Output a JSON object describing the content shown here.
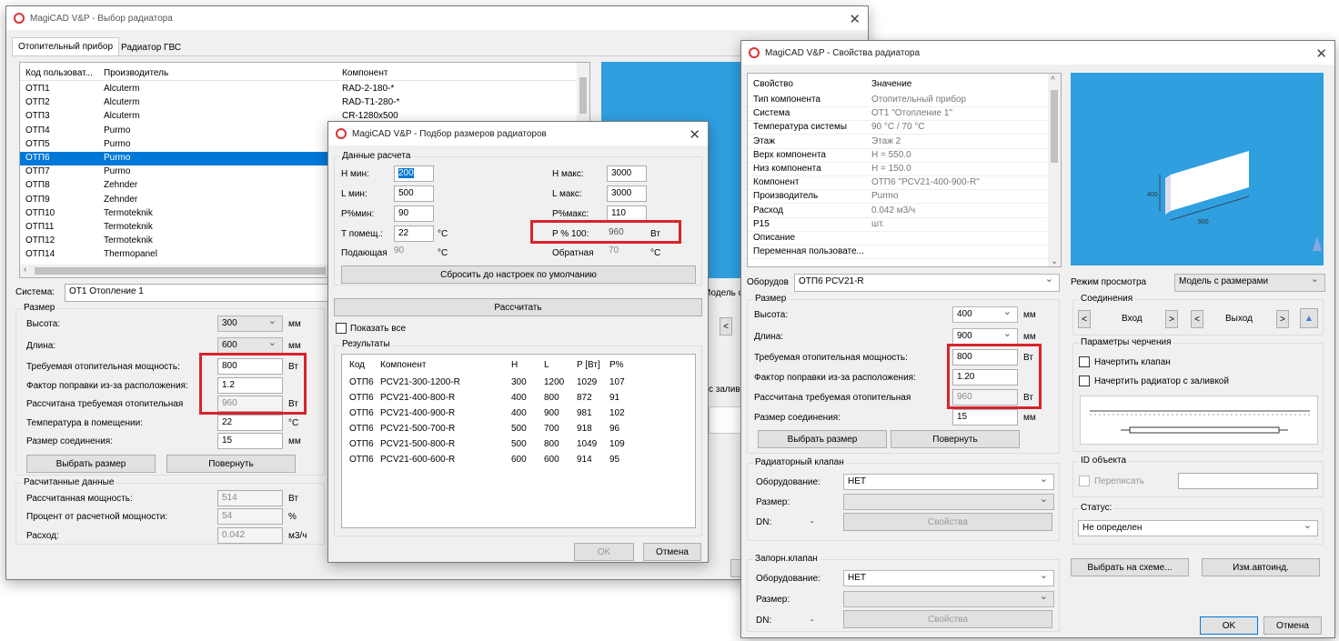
{
  "w1": {
    "title": "MagiCAD V&P - Выбор радиатора",
    "tabs": [
      "Отопительный прибор",
      "Радиатор ГВС"
    ],
    "cols": [
      "Код пользоват...",
      "Производитель",
      "Компонент"
    ],
    "rows": [
      [
        "ОТП1",
        "Alcuterm",
        "RAD-2-180-*"
      ],
      [
        "ОТП2",
        "Alcuterm",
        "RAD-T1-280-*"
      ],
      [
        "ОТП3",
        "Alcuterm",
        "CR-1280x500"
      ],
      [
        "ОТП4",
        "Purmo",
        ""
      ],
      [
        "ОТП5",
        "Purmo",
        ""
      ],
      [
        "ОТП6",
        "Purmo",
        ""
      ],
      [
        "ОТП7",
        "Purmo",
        ""
      ],
      [
        "ОТП8",
        "Zehnder",
        ""
      ],
      [
        "ОТП9",
        "Zehnder",
        ""
      ],
      [
        "ОТП10",
        "Termoteknik",
        ""
      ],
      [
        "ОТП11",
        "Termoteknik",
        ""
      ],
      [
        "ОТП12",
        "Termoteknik",
        ""
      ],
      [
        "ОТП14",
        "Thermopanel",
        ""
      ]
    ],
    "system_label": "Система:",
    "system_value": "ОТ1 Отопление 1",
    "size_group": "Размер",
    "height_label": "Высота:",
    "height_value": "300",
    "length_label": "Длина:",
    "length_value": "600",
    "mm": "мм",
    "req_power_label": "Требуемая отопительная мощность:",
    "req_power_value": "800",
    "vt": "Вт",
    "factor_label": "Фактор поправки из-за расположения:",
    "factor_value": "1.2",
    "calc_req_label": "Рассчитана требуемая отопительная",
    "calc_req_value": "960",
    "room_temp_label": "Температура в помещении:",
    "room_temp_value": "22",
    "deg": "°C",
    "conn_label": "Размер соединения:",
    "conn_value": "15",
    "select_size_btn": "Выбрать размер",
    "rotate_btn": "Повернуть",
    "calc_group": "Расчитанные данные",
    "calc_power_label": "Рассчитанная мощность:",
    "calc_power_value": "514",
    "percent_label": "Процент от расчетной мощности:",
    "percent_value": "54",
    "pct": "%",
    "flow_label": "Расход:",
    "flow_value": "0.042",
    "flow_unit": "м3/ч",
    "partial": [
      "Модель с",
      "с залив"
    ]
  },
  "w2": {
    "title": "MagiCAD V&P - Подбор размеров радиаторов",
    "calc_group": "Данные расчета",
    "hmin_label": "H мин:",
    "hmin": "200",
    "lmin_label": "L мин:",
    "lmin": "500",
    "pmin_label": "P%мин:",
    "pmin": "90",
    "troom_label": "T помещ.:",
    "troom": "22",
    "supply_label": "Подающая",
    "supply": "90",
    "hmax_label": "H макс:",
    "hmax": "3000",
    "lmax_label": "L макс:",
    "lmax": "3000",
    "pmax_label": "P%макс:",
    "pmax": "110",
    "p100_label": "P % 100:",
    "p100": "960",
    "p100_unit": "Вт",
    "return_label": "Обратная",
    "return": "70",
    "deg": "°C",
    "reset_btn": "Сбросить до настроек по умолчанию",
    "calc_btn": "Рассчитать",
    "show_all": "Показать все",
    "results_label": "Результаты",
    "res_cols": [
      "Код",
      "Компонент",
      "H",
      "L",
      "P [Вт]",
      "P%"
    ],
    "res_rows": [
      [
        "ОТП6",
        "PCV21-300-1200-R",
        "300",
        "1200",
        "1029",
        "107"
      ],
      [
        "ОТП6",
        "PCV21-400-800-R",
        "400",
        "800",
        "872",
        "91"
      ],
      [
        "ОТП6",
        "PCV21-400-900-R",
        "400",
        "900",
        "981",
        "102"
      ],
      [
        "ОТП6",
        "PCV21-500-700-R",
        "500",
        "700",
        "918",
        "96"
      ],
      [
        "ОТП6",
        "PCV21-500-800-R",
        "500",
        "800",
        "1049",
        "109"
      ],
      [
        "ОТП6",
        "PCV21-600-600-R",
        "600",
        "600",
        "914",
        "95"
      ]
    ],
    "ok": "OK",
    "cancel": "Отмена"
  },
  "w3": {
    "title": "MagiCAD V&P - Свойства радиатора",
    "prop_cols": [
      "Свойство",
      "Значение"
    ],
    "props": [
      [
        "Тип компонента",
        "Отопительный прибор"
      ],
      [
        "Система",
        "ОТ1 \"Отопление 1\""
      ],
      [
        "Температура системы",
        "90 °C / 70 °C"
      ],
      [
        "Этаж",
        "Этаж 2"
      ],
      [
        "Верх компонента",
        "H = 550.0"
      ],
      [
        "Низ компонента",
        "H = 150.0"
      ],
      [
        "Компонент",
        "ОТП6 \"PCV21-400-900-R\""
      ],
      [
        "Производитель",
        "Purmo"
      ],
      [
        "Расход",
        "0.042 м3/ч"
      ],
      [
        "P15",
        "шт."
      ],
      [
        "Описание",
        ""
      ],
      [
        "Переменная пользовате...",
        ""
      ]
    ],
    "equip_label": "Оборудов",
    "equip_value": "ОТП6   PCV21-R",
    "view_mode_label": "Режим просмотра",
    "view_mode_value": "Модель с размерами",
    "size_group": "Размер",
    "height_label": "Высота:",
    "height_value": "400",
    "length_label": "Длина:",
    "length_value": "900",
    "mm": "мм",
    "req_power_label": "Требуемая отопительная мощность:",
    "req_power_value": "800",
    "vt": "Вт",
    "factor_label": "Фактор поправки из-за расположения:",
    "factor_value": "1.20",
    "calc_req_label": "Рассчитана требуемая отопительная",
    "calc_req_value": "960",
    "conn_label": "Размер соединения:",
    "conn_value": "15",
    "select_size_btn": "Выбрать размер",
    "rotate_btn": "Повернуть",
    "conn_group": "Соединения",
    "in_label": "Вход",
    "out_label": "Выход",
    "draw_group": "Параметры черчения",
    "draw_valve": "Начертить клапан",
    "draw_fill": "Начертить радиатор с заливкой",
    "valve_group": "Радиаторный клапан",
    "equip2_label": "Оборудование:",
    "equip2_value": "НЕТ",
    "size2_label": "Размер:",
    "dn_label": "DN:",
    "dn_value": "-",
    "props_btn": "Свойства",
    "shutoff_group": "Запорн.клапан",
    "equip3_label": "Оборудование:",
    "equip3_value": "НЕТ",
    "size3_label": "Размер:",
    "dn3_label": "DN:",
    "dn3_value": "-",
    "props3_btn": "Свойства",
    "id_group": "ID объекта",
    "rewrite": "Переписать",
    "status_label": "Статус:",
    "status_value": "Не определен",
    "pick_btn": "Выбрать на схеме...",
    "autoind_btn": "Изм.автоинд.",
    "ok": "OK",
    "cancel": "Отмена",
    "dim_labels": [
      "400",
      "900"
    ]
  }
}
